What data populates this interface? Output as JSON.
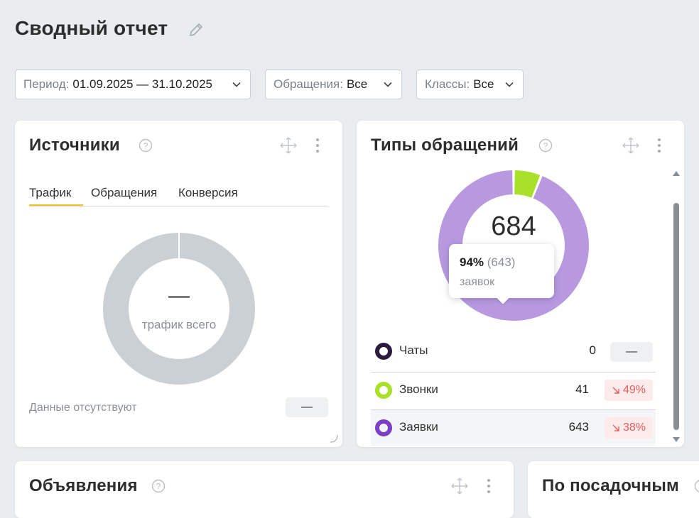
{
  "header": {
    "title": "Сводный отчет",
    "edit_icon": "pencil-icon"
  },
  "filters": [
    {
      "label": "Период:",
      "value": "01.09.2025 — 31.10.2025"
    },
    {
      "label": "Обращения:",
      "value": "Все"
    },
    {
      "label": "Классы:",
      "value": "Все"
    }
  ],
  "sources": {
    "title": "Источники",
    "tabs": [
      "Трафик",
      "Обращения",
      "Конверсия"
    ],
    "active_tab": "Трафик",
    "total_value": "—",
    "total_label": "трафик всего",
    "no_data": "Данные отсутствуют",
    "badge": "—",
    "ring_color": "#cbd0d4"
  },
  "types": {
    "title": "Типы обращений",
    "total": "684",
    "tooltip": {
      "percent": "94%",
      "count": "(643)",
      "label": "заявок"
    },
    "legend": [
      {
        "name": "Чаты",
        "value": "0",
        "change": "—",
        "color": "#2d1b3d"
      },
      {
        "name": "Звонки",
        "value": "41",
        "change": "49%",
        "color": "#a8e02a"
      },
      {
        "name": "Заявки",
        "value": "643",
        "change": "38%",
        "color": "#7b3fc4"
      }
    ],
    "ring_colors": {
      "calls": "#a8e02a",
      "requests": "#b899e0"
    }
  },
  "chart_data": {
    "type": "pie",
    "categories": [
      "Чаты",
      "Звонки",
      "Заявки"
    ],
    "values": [
      0,
      41,
      643
    ],
    "title": "Типы обращений"
  },
  "ads": {
    "title": "Объявления"
  },
  "landing": {
    "title": "По посадочным"
  },
  "colors": {
    "accent_tab": "#f0c419",
    "down_badge_bg": "#fdeaea",
    "down_badge_text": "#e0605e"
  }
}
